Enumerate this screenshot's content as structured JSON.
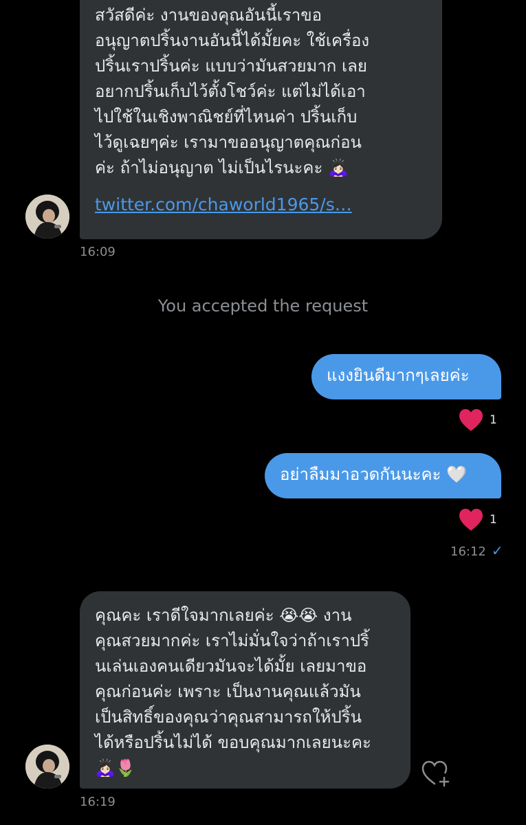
{
  "conversation": {
    "messages": [
      {
        "text": "สวัสดีค่ะ งานของคุณอันนี้เราขอ\nอนุญาตปริ้นงานอันนี้ได้มั้ยคะ ใช้เครื่อง\nปริ้นเราปริ้นค่ะ แบบว่ามันสวยมาก เลย\nอยากปริ้นเก็บไว้ตั้งโชว์ค่ะ แต่ไม่ได้เอา\nไปใช้ในเชิงพาณิชย์ที่ไหนค่า ปริ้นเก็บ\nไว้ดูเฉยๆค่ะ เรามาขออนุญาตคุณก่อน\nค่ะ ถ้าไม่อนุญาต ไม่เป็นไรนะคะ 🙇🏻‍♀️",
        "link": "twitter.com/chaworld1965/s…",
        "time": "16:09"
      },
      {
        "system_text": "You accepted the request"
      },
      {
        "text": "แงงยินดีมากๆเลยค่ะ",
        "reaction": {
          "emoji": "heart",
          "count": "1"
        }
      },
      {
        "text": "อย่าลืมมาอวดกันนะคะ 🤍",
        "reaction": {
          "emoji": "heart",
          "count": "1"
        },
        "time": "16:12",
        "status": "✓"
      },
      {
        "text": "คุณคะ เราดีใจมากเลยค่ะ 😭😭 งาน\nคุณสวยมากค่ะ เราไม่มั่นใจว่าถ้าเราปริ้\nนเล่นเองคนเดียวมันจะได้มั้ย เลยมาขอ\nคุณก่อนค่ะ เพราะ เป็นงานคุณแล้วมัน\nเป็นสิทธิ์ของคุณว่าคุณสามารถให้ปริ้น\nได้หรือปริ้นไม่ได้ ขอบคุณมากเลยนะคะ\n🙇🏻‍♀️🌷",
        "time": "16:19"
      }
    ]
  },
  "colors": {
    "background": "#000000",
    "incoming_bubble": "#2f3336",
    "outgoing_bubble": "#4a99e9",
    "heart": "#e0245e",
    "muted_text": "#8b8f93"
  },
  "icons": {
    "reaction": "heart-icon",
    "add_reaction": "heart-plus-icon",
    "sent_status": "checkmark-icon",
    "avatar": "avatar-photo"
  }
}
